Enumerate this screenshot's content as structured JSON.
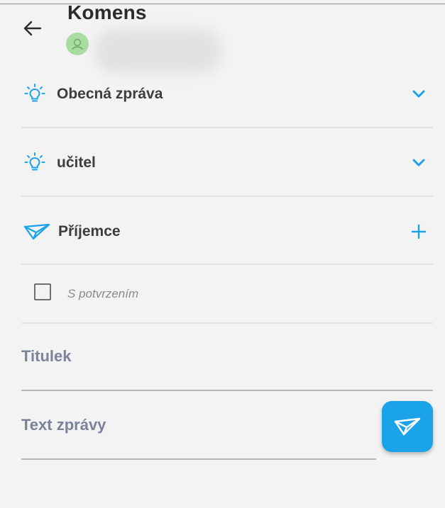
{
  "header": {
    "title": "Komens",
    "back_icon": "arrow-left-icon",
    "avatar_icon": "user-avatar-icon"
  },
  "form": {
    "message_type": {
      "label": "Obecná zpráva",
      "icon": "lightbulb-icon",
      "action_icon": "chevron-down-icon"
    },
    "sender_role": {
      "label": "učitel",
      "icon": "lightbulb-icon",
      "action_icon": "chevron-down-icon"
    },
    "recipients": {
      "label": "Příjemce",
      "icon": "paper-plane-icon",
      "action_icon": "plus-icon"
    },
    "confirmation": {
      "label": "S potvrzením",
      "checked": false
    },
    "subject_placeholder": "Titulek",
    "body_placeholder": "Text zprávy",
    "send_icon": "paper-plane-icon"
  },
  "colors": {
    "accent": "#1ba3e8",
    "background": "#f3f3f4",
    "avatar": "#a8dca0",
    "placeholder_text": "#7b8399"
  }
}
